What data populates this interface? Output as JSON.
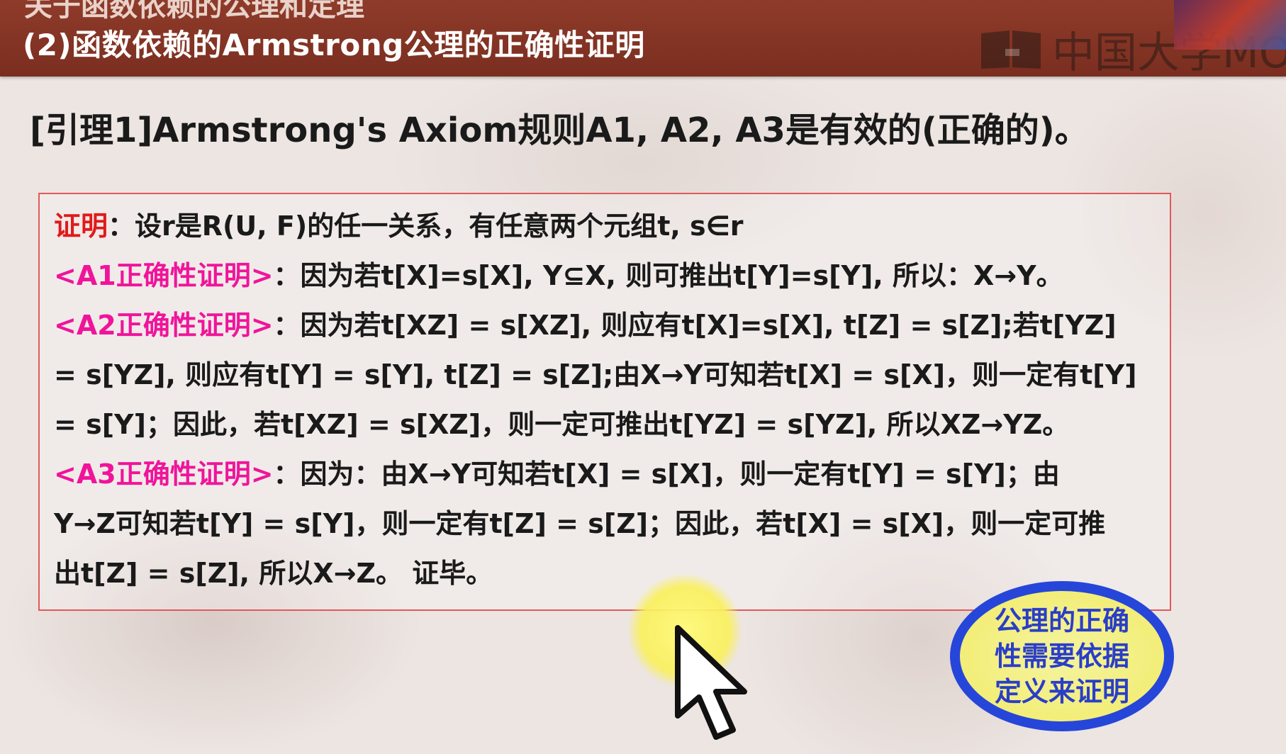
{
  "header": {
    "prev_line": "关于函数依赖的公理和定理",
    "title": "(2)函数依赖的Armstrong公理的正确性证明",
    "watermark_text": "中国大学MO"
  },
  "lemma": "[引理1]Armstrong's  Axiom规则A1, A2, A3是有效的(正确的)。",
  "proof": {
    "line1_label": "证明",
    "line1_text": "：设r是R(U, F)的任一关系，有任意两个元组t, s∈r",
    "a1_label": "<A1正确性证明>",
    "a1_text": "：因为若t[X]=s[X], Y⊆X, 则可推出t[Y]=s[Y], 所以：X→Y。",
    "a2_label": "<A2正确性证明>",
    "a2_text1": "：因为若t[XZ] = s[XZ], 则应有t[X]=s[X], t[Z] = s[Z];若t[YZ]",
    "a2_text2": "= s[YZ], 则应有t[Y] = s[Y], t[Z] = s[Z];由X→Y可知若t[X] = s[X]，则一定有t[Y]",
    "a2_text3": "= s[Y]；因此，若t[XZ] = s[XZ]，则一定可推出t[YZ] = s[YZ], 所以XZ→YZ。",
    "a3_label": "<A3正确性证明>",
    "a3_text1": "：因为：由X→Y可知若t[X] = s[X]，则一定有t[Y] = s[Y]；由",
    "a3_text2": "Y→Z可知若t[Y] = s[Y]，则一定有t[Z] = s[Z]；因此，若t[X] = s[X]，则一定可推",
    "a3_text3": "出t[Z] = s[Z], 所以X→Z。 证毕。"
  },
  "callout": "公理的正确性需要依据定义来证明",
  "colors": {
    "header_bg": "#7a2e20",
    "proof_label": "#e11a1a",
    "section_label": "#f0149a",
    "callout_border": "#2646d9",
    "callout_text": "#2a3ec8"
  }
}
